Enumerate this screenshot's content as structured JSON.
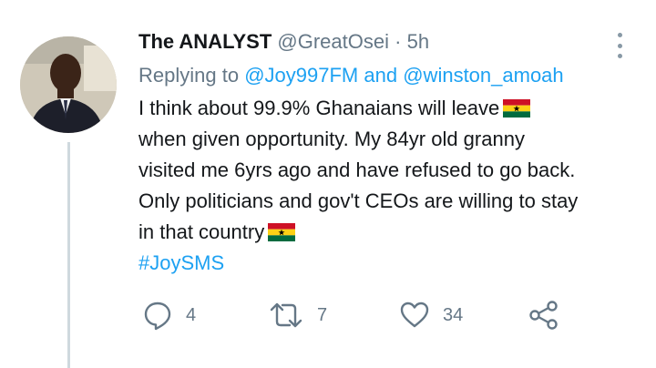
{
  "tweet": {
    "display_name": "The ANALYST",
    "handle": "@GreatOsei",
    "separator": "·",
    "time": "5h",
    "replying_prefix": "Replying to",
    "replying_mention_1": "@Joy997FM",
    "replying_and": "and",
    "replying_mention_2": "@winston_amoah",
    "body_line_1": "I think about 99.9% Ghanaians will leave",
    "body_line_2": "when given opportunity. My 84yr old granny",
    "body_line_3": "visited me 6yrs ago and have refused to go back.",
    "body_line_4": "Only politicians and gov't CEOs are willing to stay",
    "body_line_5": "in that country",
    "hashtag": "#JoySMS",
    "flag_emoji": "ghana-flag-icon"
  },
  "actions": {
    "reply_count": "4",
    "retweet_count": "7",
    "like_count": "34"
  },
  "colors": {
    "link": "#1da1f2",
    "muted": "#657786",
    "text": "#14171a",
    "thread_line": "#cfd9de"
  }
}
